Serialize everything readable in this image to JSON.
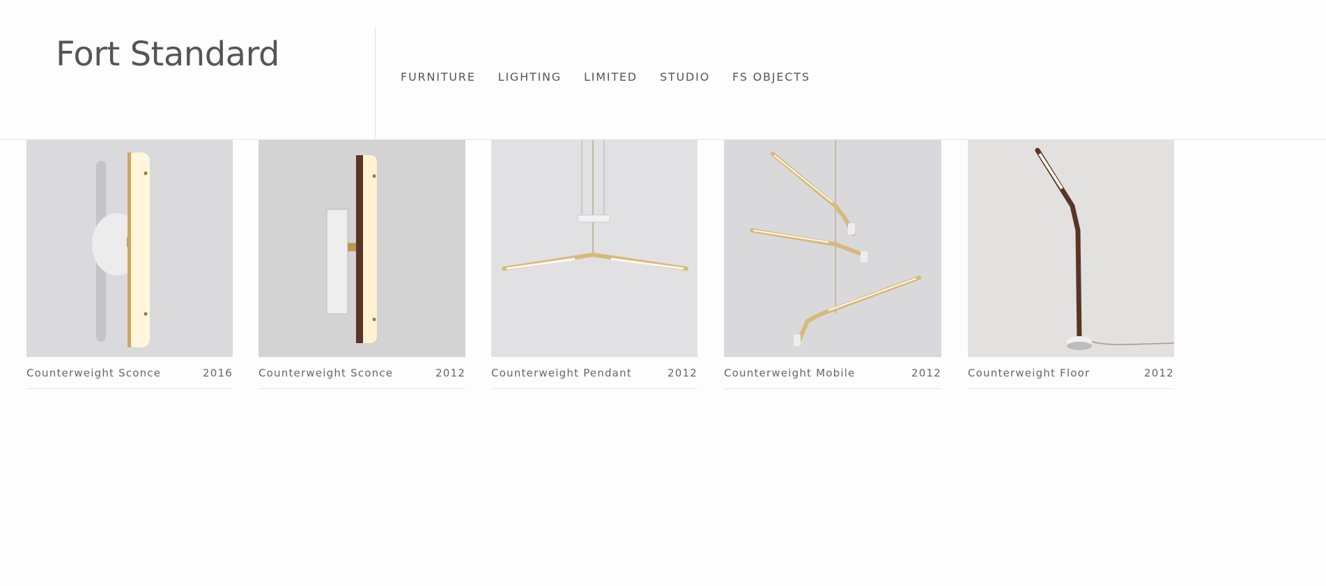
{
  "header": {
    "logo": "Fort Standard",
    "nav": [
      "FURNITURE",
      "LIGHTING",
      "LIMITED",
      "STUDIO",
      "FS OBJECTS"
    ]
  },
  "products": [
    {
      "name": "Counterweight Sconce",
      "year": "2016",
      "image_icon": "wall-sconce-image"
    },
    {
      "name": "Counterweight Sconce",
      "year": "2012",
      "image_icon": "wall-sconce-image"
    },
    {
      "name": "Counterweight Pendant",
      "year": "2012",
      "image_icon": "pendant-lamp-image"
    },
    {
      "name": "Counterweight Mobile",
      "year": "2012",
      "image_icon": "mobile-lamp-image"
    },
    {
      "name": "Counterweight Floor",
      "year": "2012",
      "image_icon": "floor-lamp-image"
    }
  ]
}
